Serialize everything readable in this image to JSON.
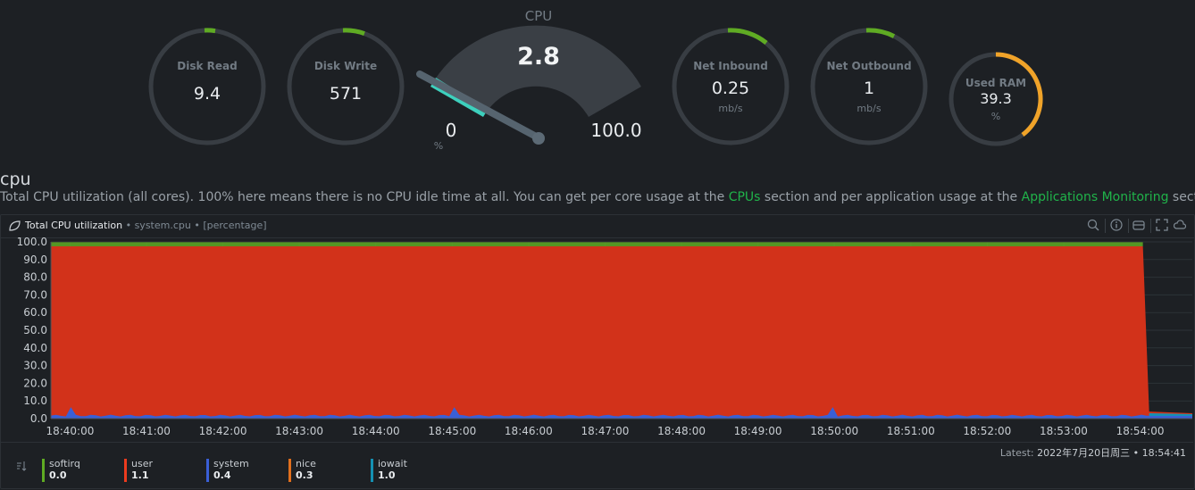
{
  "gauges": {
    "disk_read": {
      "title": "Disk Read",
      "value": "9.4",
      "color": "#5fab23"
    },
    "disk_write": {
      "title": "Disk Write",
      "value": "571",
      "color": "#5fab23"
    },
    "net_inbound": {
      "title": "Net Inbound",
      "value": "0.25",
      "unit": "mb/s",
      "color": "#5fab23"
    },
    "net_outbound": {
      "title": "Net Outbound",
      "value": "1",
      "unit": "mb/s",
      "color": "#5fab23"
    },
    "used_ram": {
      "title": "Used RAM",
      "value": "39.3",
      "unit": "%",
      "color": "#f0a329",
      "level_percent": 39.3
    }
  },
  "cpu_gauge": {
    "title": "CPU",
    "value": "2.8",
    "min": "0",
    "max": "100.0",
    "unit": "%",
    "level_percent": 2.8,
    "color": "#3dd0bd"
  },
  "section": {
    "title": "cpu",
    "desc_1": "Total CPU utilization (all cores). 100% here means there is no CPU idle time at all. You can get per core usage at the ",
    "link_cpus": "CPUs",
    "desc_2": " section and per application usage at the ",
    "link_apps": "Applications Monitoring",
    "desc_3": " section."
  },
  "chart_header": {
    "title": "Total CPU utilization",
    "context": "• system.cpu",
    "units": "• [percentage]"
  },
  "latest": {
    "label": "Latest:",
    "value": "2022年7月20日周三 • 18:54:41"
  },
  "legend": [
    {
      "name": "softirq",
      "value": "0.0",
      "color": "#5fab23"
    },
    {
      "name": "user",
      "value": "1.1",
      "color": "#ec3b1e"
    },
    {
      "name": "system",
      "value": "0.4",
      "color": "#3a5fd6"
    },
    {
      "name": "nice",
      "value": "0.3",
      "color": "#e06f1d"
    },
    {
      "name": "iowait",
      "value": "1.0",
      "color": "#1591b3"
    }
  ],
  "chart_data": {
    "type": "area",
    "title": "Total CPU utilization",
    "ylabel": "percentage",
    "ylim": [
      0,
      100
    ],
    "y_ticks": [
      "0.0",
      "10.0",
      "20.0",
      "30.0",
      "40.0",
      "50.0",
      "60.0",
      "70.0",
      "80.0",
      "90.0",
      "100.0"
    ],
    "x_ticks": [
      "18:40:00",
      "18:41:00",
      "18:42:00",
      "18:43:00",
      "18:44:00",
      "18:45:00",
      "18:46:00",
      "18:47:00",
      "18:48:00",
      "18:49:00",
      "18:50:00",
      "18:51:00",
      "18:52:00",
      "18:53:00",
      "18:54:00"
    ],
    "x_range": [
      "18:39:45",
      "18:54:41"
    ],
    "stacked": true,
    "series": [
      {
        "name": "system",
        "color": "#3a5fd6",
        "note_values": "approx 1-2 % with spikes ~7 % near 18:40:00, 18:45:00, 18:50:00"
      },
      {
        "name": "user",
        "color": "#d2321a",
        "values_summary": "~97 % from 18:39:45 to 18:54:05, then drops to ~1 %"
      },
      {
        "name": "softirq",
        "color": "#5fab23",
        "values_summary": "near 0 %, thin band at top"
      }
    ]
  }
}
